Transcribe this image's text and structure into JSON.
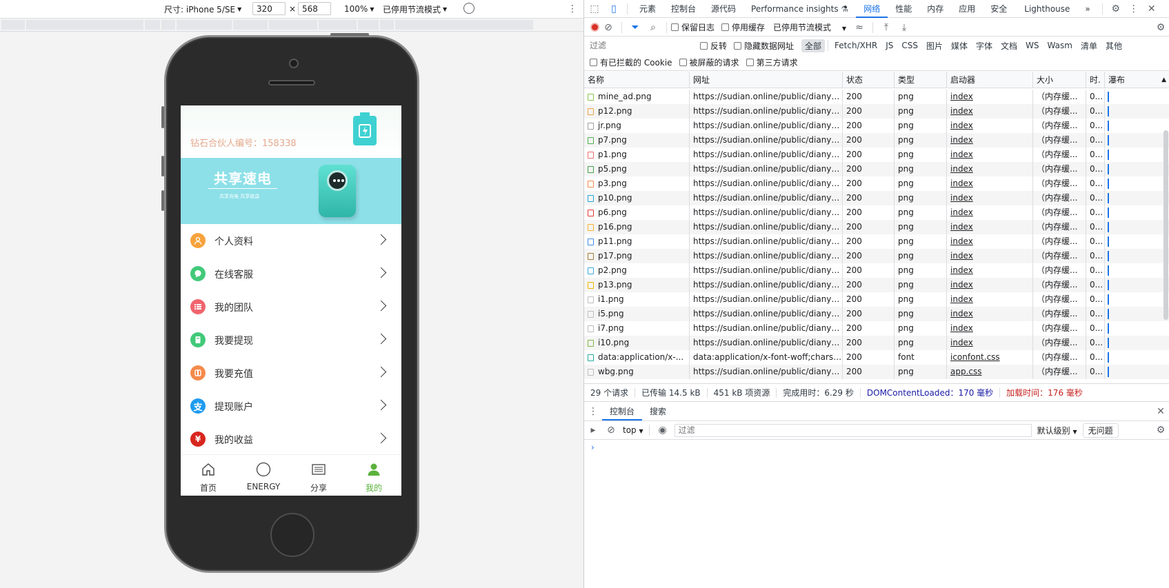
{
  "device_toolbar": {
    "dimensions_label": "尺寸: iPhone 5/SE",
    "width": "320",
    "times": "×",
    "height": "568",
    "zoom": "100%",
    "throttling": "已停用节流模式"
  },
  "mobile_app": {
    "partner_id_text": "钻石合伙人编号：158338",
    "banner_title": "共享速电",
    "banner_subtitle": "共享充电 共享收益",
    "menu": [
      {
        "label": "个人资料",
        "icon": "person-icon",
        "color": "#f7a23c"
      },
      {
        "label": "在线客服",
        "icon": "chat-icon",
        "color": "#42c97a"
      },
      {
        "label": "我的团队",
        "icon": "list-icon",
        "color": "#f0646e"
      },
      {
        "label": "我要提现",
        "icon": "withdraw-icon",
        "color": "#42c97a"
      },
      {
        "label": "我要充值",
        "icon": "recharge-icon",
        "color": "#f58a4b"
      },
      {
        "label": "提现账户",
        "icon": "alipay-icon",
        "color": "#1e9bf0"
      },
      {
        "label": "我的收益",
        "icon": "yuan-icon",
        "color": "#d8261e"
      }
    ],
    "tabs": [
      {
        "label": "首页",
        "icon": "home-icon"
      },
      {
        "label": "ENERGY",
        "icon": "circle-icon"
      },
      {
        "label": "分享",
        "icon": "share-list-icon"
      },
      {
        "label": "我的",
        "icon": "user-icon",
        "active": true
      }
    ],
    "accent_color": "#5ab23c"
  },
  "devtools": {
    "tabs": [
      "元素",
      "控制台",
      "源代码",
      "Performance insights ⚗",
      "网络",
      "性能",
      "内存",
      "应用",
      "安全",
      "Lighthouse",
      "»"
    ],
    "active_tab": "网络",
    "network_toolbar": {
      "preserve_log": "保留日志",
      "disable_cache": "停用缓存",
      "throttling": "已停用节流模式"
    },
    "filter": {
      "placeholder": "过滤",
      "invert": "反转",
      "hide_data_urls": "隐藏数据网址",
      "types": [
        "全部",
        "Fetch/XHR",
        "JS",
        "CSS",
        "图片",
        "媒体",
        "字体",
        "文档",
        "WS",
        "Wasm",
        "清单",
        "其他"
      ],
      "blocked_cookies": "有已拦截的 Cookie",
      "blocked_requests": "被屏蔽的请求",
      "third_party": "第三方请求"
    },
    "columns": [
      "名称",
      "网址",
      "状态",
      "类型",
      "启动器",
      "大小",
      "时.",
      "瀑布"
    ],
    "rows": [
      {
        "name": "mine_ad.png",
        "url": "https://sudian.online/public/dianyun/i...",
        "status": "200",
        "type": "png",
        "initiator": "index",
        "size": "（内存缓...",
        "time": "0..."
      },
      {
        "name": "p12.png",
        "url": "https://sudian.online/public/dianyun/i...",
        "status": "200",
        "type": "png",
        "initiator": "index",
        "size": "（内存缓...",
        "time": "0..."
      },
      {
        "name": "jr.png",
        "url": "https://sudian.online/public/dianyun/i...",
        "status": "200",
        "type": "png",
        "initiator": "index",
        "size": "（内存缓...",
        "time": "0..."
      },
      {
        "name": "p7.png",
        "url": "https://sudian.online/public/dianyun/i...",
        "status": "200",
        "type": "png",
        "initiator": "index",
        "size": "（内存缓...",
        "time": "0..."
      },
      {
        "name": "p1.png",
        "url": "https://sudian.online/public/dianyun/i...",
        "status": "200",
        "type": "png",
        "initiator": "index",
        "size": "（内存缓...",
        "time": "0..."
      },
      {
        "name": "p5.png",
        "url": "https://sudian.online/public/dianyun/i...",
        "status": "200",
        "type": "png",
        "initiator": "index",
        "size": "（内存缓...",
        "time": "0..."
      },
      {
        "name": "p3.png",
        "url": "https://sudian.online/public/dianyun/i...",
        "status": "200",
        "type": "png",
        "initiator": "index",
        "size": "（内存缓...",
        "time": "0..."
      },
      {
        "name": "p10.png",
        "url": "https://sudian.online/public/dianyun/i...",
        "status": "200",
        "type": "png",
        "initiator": "index",
        "size": "（内存缓...",
        "time": "0..."
      },
      {
        "name": "p6.png",
        "url": "https://sudian.online/public/dianyun/i...",
        "status": "200",
        "type": "png",
        "initiator": "index",
        "size": "（内存缓...",
        "time": "0..."
      },
      {
        "name": "p16.png",
        "url": "https://sudian.online/public/dianyun/i...",
        "status": "200",
        "type": "png",
        "initiator": "index",
        "size": "（内存缓...",
        "time": "0..."
      },
      {
        "name": "p11.png",
        "url": "https://sudian.online/public/dianyun/i...",
        "status": "200",
        "type": "png",
        "initiator": "index",
        "size": "（内存缓...",
        "time": "0..."
      },
      {
        "name": "p17.png",
        "url": "https://sudian.online/public/dianyun/i...",
        "status": "200",
        "type": "png",
        "initiator": "index",
        "size": "（内存缓...",
        "time": "0..."
      },
      {
        "name": "p2.png",
        "url": "https://sudian.online/public/dianyun/i...",
        "status": "200",
        "type": "png",
        "initiator": "index",
        "size": "（内存缓...",
        "time": "0..."
      },
      {
        "name": "p13.png",
        "url": "https://sudian.online/public/dianyun/i...",
        "status": "200",
        "type": "png",
        "initiator": "index",
        "size": "（内存缓...",
        "time": "0..."
      },
      {
        "name": "i1.png",
        "url": "https://sudian.online/public/dianyun/i...",
        "status": "200",
        "type": "png",
        "initiator": "index",
        "size": "（内存缓...",
        "time": "0..."
      },
      {
        "name": "i5.png",
        "url": "https://sudian.online/public/dianyun/i...",
        "status": "200",
        "type": "png",
        "initiator": "index",
        "size": "（内存缓...",
        "time": "0..."
      },
      {
        "name": "i7.png",
        "url": "https://sudian.online/public/dianyun/i...",
        "status": "200",
        "type": "png",
        "initiator": "index",
        "size": "（内存缓...",
        "time": "0..."
      },
      {
        "name": "i10.png",
        "url": "https://sudian.online/public/dianyun/i...",
        "status": "200",
        "type": "png",
        "initiator": "index",
        "size": "（内存缓...",
        "time": "0..."
      },
      {
        "name": "data:application/x-...",
        "url": "data:application/x-font-woff;charset=...",
        "status": "200",
        "type": "font",
        "initiator": "iconfont.css",
        "size": "（内存缓...",
        "time": "0..."
      },
      {
        "name": "wbg.png",
        "url": "https://sudian.online/public/dianyun/i...",
        "status": "200",
        "type": "png",
        "initiator": "app.css",
        "size": "（内存缓...",
        "time": "0..."
      }
    ],
    "summary": {
      "requests": "29 个请求",
      "transferred": "已传输 14.5 kB",
      "resources": "451 kB 项资源",
      "finish": "完成用时：6.29 秒",
      "dcl": "DOMContentLoaded：170 毫秒",
      "load": "加载时间：176 毫秒"
    },
    "drawer_tabs": [
      "控制台",
      "搜索"
    ],
    "console": {
      "context": "top",
      "filter_placeholder": "过滤",
      "level": "默认级别",
      "issues": "无问题",
      "prompt": "›"
    }
  }
}
